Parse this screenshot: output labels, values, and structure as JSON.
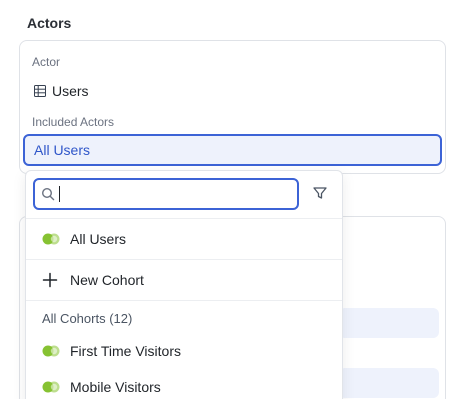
{
  "section": {
    "title": "Actors"
  },
  "actor": {
    "label": "Actor",
    "value": "Users",
    "icon": "table-icon"
  },
  "included": {
    "label": "Included Actors",
    "selected": "All Users"
  },
  "dropdown": {
    "search": {
      "value": "",
      "placeholder": "",
      "icon": "search-icon"
    },
    "filter_icon": "filter-icon",
    "items": [
      {
        "label": "All Users",
        "icon": "cohort-icon"
      },
      {
        "label": "New Cohort",
        "icon": "plus-icon"
      }
    ],
    "group": {
      "label": "All Cohorts (12)",
      "items": [
        {
          "label": "First Time Visitors",
          "icon": "cohort-icon"
        },
        {
          "label": "Mobile Visitors",
          "icon": "cohort-icon"
        }
      ]
    }
  },
  "colors": {
    "accent": "#3c63d6",
    "cohort_green": "#86c232",
    "selected_bg": "#eef2fc"
  }
}
